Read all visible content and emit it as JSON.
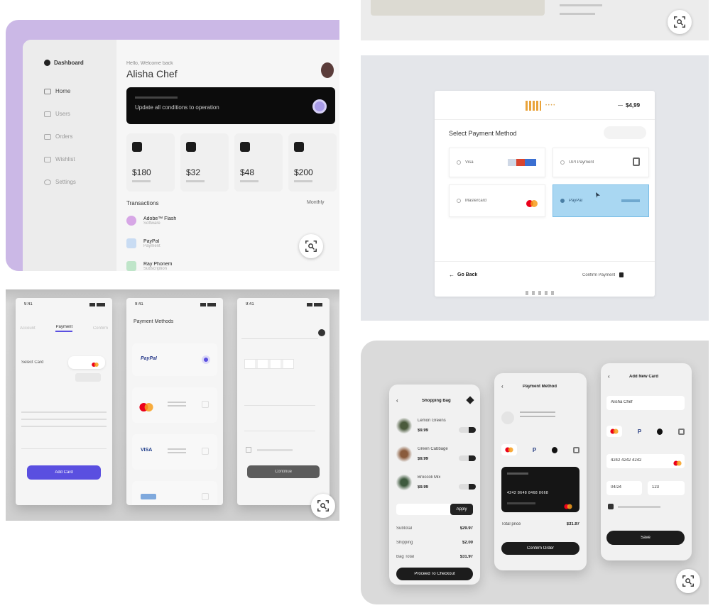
{
  "top_left": {
    "sidebar": {
      "brand": "Dashboard",
      "items": [
        "Home",
        "Users",
        "Orders",
        "Wishlist",
        "Settings"
      ]
    },
    "greeting_small": "Hello, Welcome back",
    "user_name": "Alisha Chef",
    "banner_text": "Update all conditions to operation",
    "stats": [
      "$180",
      "$32",
      "$48",
      "$200"
    ],
    "section_title": "Transactions",
    "filter_label": "Monthly",
    "transactions": [
      {
        "name": "Adobe™ Flash",
        "sub": "Software"
      },
      {
        "name": "PayPal",
        "sub": "Payment"
      },
      {
        "name": "Ray Phonem",
        "sub": "Subscription"
      }
    ]
  },
  "top_right_payment": {
    "brand_dots": "• • • •",
    "price": "$4,99",
    "price_prefix": "—",
    "title": "Select Payment Method",
    "options": [
      "Visa",
      "UPI Payment",
      "Mastercard",
      "PayPal"
    ],
    "back_label": "Go Back",
    "confirm_label": "Confirm Payment"
  },
  "bottom_left": {
    "phone1": {
      "time": "9:41",
      "tabs": [
        "Account",
        "Payment",
        "Confirm"
      ],
      "select_label": "Select Card",
      "button_label": "Add Card"
    },
    "phone2": {
      "time": "9:41",
      "title": "Payment Methods",
      "paypal": "PayPal",
      "visa": "VISA"
    },
    "phone3": {
      "time": "9:41",
      "button_label": "Continue"
    }
  },
  "bottom_right": {
    "phone1": {
      "title": "Shopping Bag",
      "items": [
        {
          "name": "Lemon Greens",
          "price": "$9.99"
        },
        {
          "name": "Green Cabbage",
          "price": "$9.99"
        },
        {
          "name": "Broccoli Mix",
          "price": "$9.99"
        }
      ],
      "promo_button": "Apply",
      "summary": [
        {
          "label": "Subtotal",
          "value": "$29.97"
        },
        {
          "label": "Shipping",
          "value": "$2.00"
        },
        {
          "label": "Bag Total",
          "value": "$31.97"
        }
      ],
      "checkout": "Proceed To Checkout"
    },
    "phone2": {
      "title": "Payment Method",
      "card_number": "4242  8648 8468  8668",
      "total_label": "Total price",
      "total_value": "$31.97",
      "button": "Confirm Order"
    },
    "phone3": {
      "title": "Add New Card",
      "name_value": "Alisha Chef",
      "number_value": "4242 4242 4242",
      "exp_value": "04/24",
      "cvv_value": "123",
      "button": "Save"
    }
  },
  "colors": {
    "purple_bg": "#cbb8e6",
    "accent_purple": "#5a4fe0",
    "panel_gray": "#e4e6ea",
    "tile_gray": "#e8e8e8"
  }
}
